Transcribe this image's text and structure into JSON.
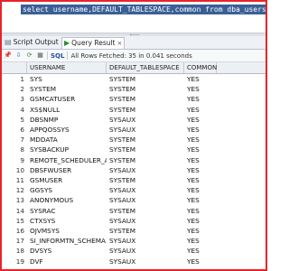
{
  "editor": {
    "sql": "select username,DEFAULT_TABLESPACE,common from dba_users;"
  },
  "tabs": [
    {
      "label": "Script Output",
      "icon": "script-output-icon"
    },
    {
      "label": "Query Result",
      "icon": "query-result-icon"
    }
  ],
  "toolbar": {
    "sql_label": "SQL",
    "status": "All Rows Fetched: 35 in 0.041 seconds"
  },
  "grid": {
    "columns": [
      "USERNAME",
      "DEFAULT_TABLESPACE",
      "COMMON"
    ],
    "rows": [
      [
        "1",
        "SYS",
        "SYSTEM",
        "YES"
      ],
      [
        "2",
        "SYSTEM",
        "SYSTEM",
        "YES"
      ],
      [
        "3",
        "GSMCATUSER",
        "SYSTEM",
        "YES"
      ],
      [
        "4",
        "XS$NULL",
        "SYSTEM",
        "YES"
      ],
      [
        "5",
        "DBSNMP",
        "SYSAUX",
        "YES"
      ],
      [
        "6",
        "APPQOSSYS",
        "SYSAUX",
        "YES"
      ],
      [
        "7",
        "MDDATA",
        "SYSTEM",
        "YES"
      ],
      [
        "8",
        "SYSBACKUP",
        "SYSTEM",
        "YES"
      ],
      [
        "9",
        "REMOTE_SCHEDULER_AGENT",
        "SYSTEM",
        "YES"
      ],
      [
        "10",
        "DBSFWUSER",
        "SYSAUX",
        "YES"
      ],
      [
        "11",
        "GSMUSER",
        "SYSTEM",
        "YES"
      ],
      [
        "12",
        "GGSYS",
        "SYSAUX",
        "YES"
      ],
      [
        "13",
        "ANONYMOUS",
        "SYSAUX",
        "YES"
      ],
      [
        "14",
        "SYSRAC",
        "SYSTEM",
        "YES"
      ],
      [
        "15",
        "CTXSYS",
        "SYSAUX",
        "YES"
      ],
      [
        "16",
        "OJVMSYS",
        "SYSTEM",
        "YES"
      ],
      [
        "17",
        "SI_INFORMTN_SCHEMA",
        "SYSAUX",
        "YES"
      ],
      [
        "18",
        "DVSYS",
        "SYSAUX",
        "YES"
      ],
      [
        "19",
        "DVF",
        "SYSAUX",
        "YES"
      ],
      [
        "20",
        "AUDSYS",
        "SYSAUX",
        "YES"
      ]
    ]
  },
  "colors": {
    "frame": "#e8242a",
    "selection": "#3a5f96"
  }
}
